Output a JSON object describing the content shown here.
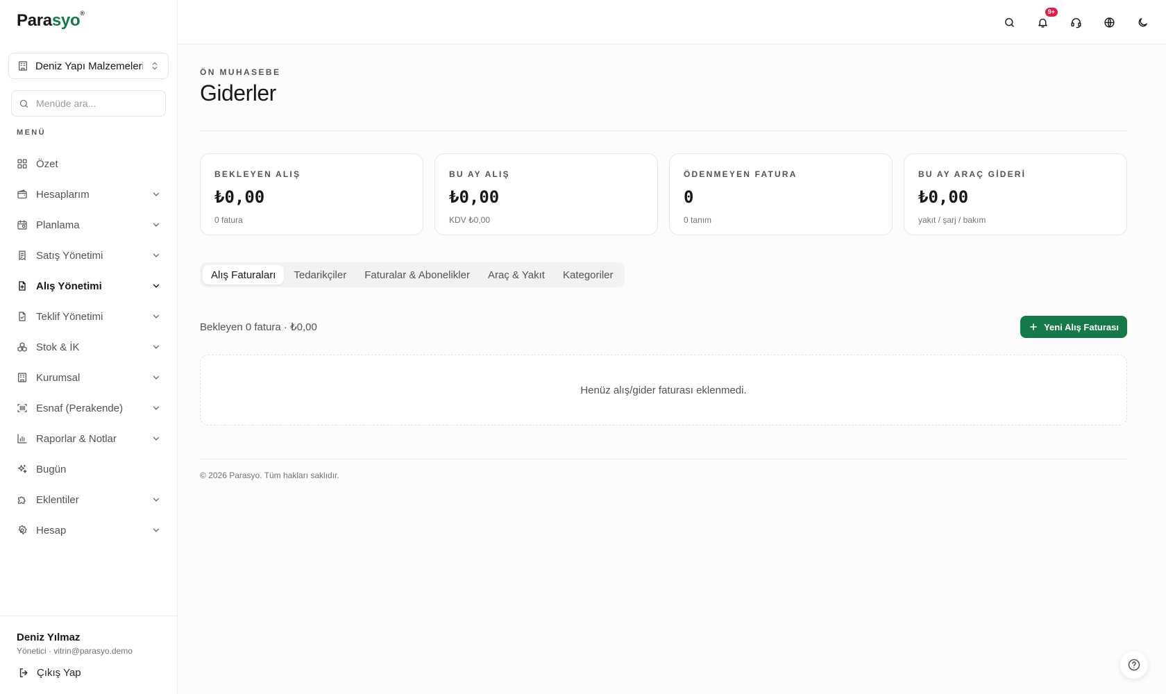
{
  "brand": {
    "name_start": "Para",
    "name_end": "syo",
    "mark": "®"
  },
  "company_switcher": {
    "name": "Deniz Yapı Malzemeleri..."
  },
  "menu_search": {
    "placeholder": "Menüde ara..."
  },
  "menu_heading": "MENÜ",
  "menu": [
    {
      "label": "Özet",
      "icon": "dashboard-icon",
      "has_children": false
    },
    {
      "label": "Hesaplarım",
      "icon": "wallet-icon",
      "has_children": true
    },
    {
      "label": "Planlama",
      "icon": "calendar-icon",
      "has_children": true
    },
    {
      "label": "Satış Yönetimi",
      "icon": "receipt-icon",
      "has_children": true
    },
    {
      "label": "Alış Yönetimi",
      "icon": "file-plus-icon",
      "has_children": true,
      "active": true
    },
    {
      "label": "Teklif Yönetimi",
      "icon": "file-check-icon",
      "has_children": true
    },
    {
      "label": "Stok & İK",
      "icon": "boxes-icon",
      "has_children": true
    },
    {
      "label": "Kurumsal",
      "icon": "building-icon",
      "has_children": true
    },
    {
      "label": "Esnaf (Perakende)",
      "icon": "barcode-icon",
      "has_children": true
    },
    {
      "label": "Raporlar & Notlar",
      "icon": "bar-chart-icon",
      "has_children": true
    },
    {
      "label": "Bugün",
      "icon": "sparkles-icon",
      "has_children": false
    },
    {
      "label": "Eklentiler",
      "icon": "puzzle-icon",
      "has_children": true
    },
    {
      "label": "Hesap",
      "icon": "gear-icon",
      "has_children": true
    }
  ],
  "user": {
    "name": "Deniz Yılmaz",
    "meta": "Yönetici · vitrin@parasyo.demo",
    "logout_label": "Çıkış Yap"
  },
  "topbar": {
    "notification_badge": "9+"
  },
  "page": {
    "eyebrow": "ÖN MUHASEBE",
    "title": "Giderler"
  },
  "stats": [
    {
      "label": "BEKLEYEN ALIŞ",
      "value": "₺0,00",
      "sub": "0 fatura"
    },
    {
      "label": "BU AY ALIŞ",
      "value": "₺0,00",
      "sub": "KDV ₺0,00"
    },
    {
      "label": "ÖDENMEYEN FATURA",
      "value": "0",
      "sub": "0 tanım"
    },
    {
      "label": "BU AY ARAÇ GİDERİ",
      "value": "₺0,00",
      "sub": "yakıt / şarj / bakım"
    }
  ],
  "tabs": [
    {
      "label": "Alış Faturaları",
      "active": true
    },
    {
      "label": "Tedarikçiler"
    },
    {
      "label": "Faturalar & Abonelikler"
    },
    {
      "label": "Araç & Yakıt"
    },
    {
      "label": "Kategoriler"
    }
  ],
  "summary": "Bekleyen 0 fatura · ₺0,00",
  "new_button_label": "Yeni Alış Faturası",
  "empty_message": "Henüz alış/gider faturası eklenmedi.",
  "copyright": "© 2026 Parasyo. Tüm hakları saklıdır.",
  "colors": {
    "accent": "#16794a",
    "badge": "#e11d48"
  }
}
